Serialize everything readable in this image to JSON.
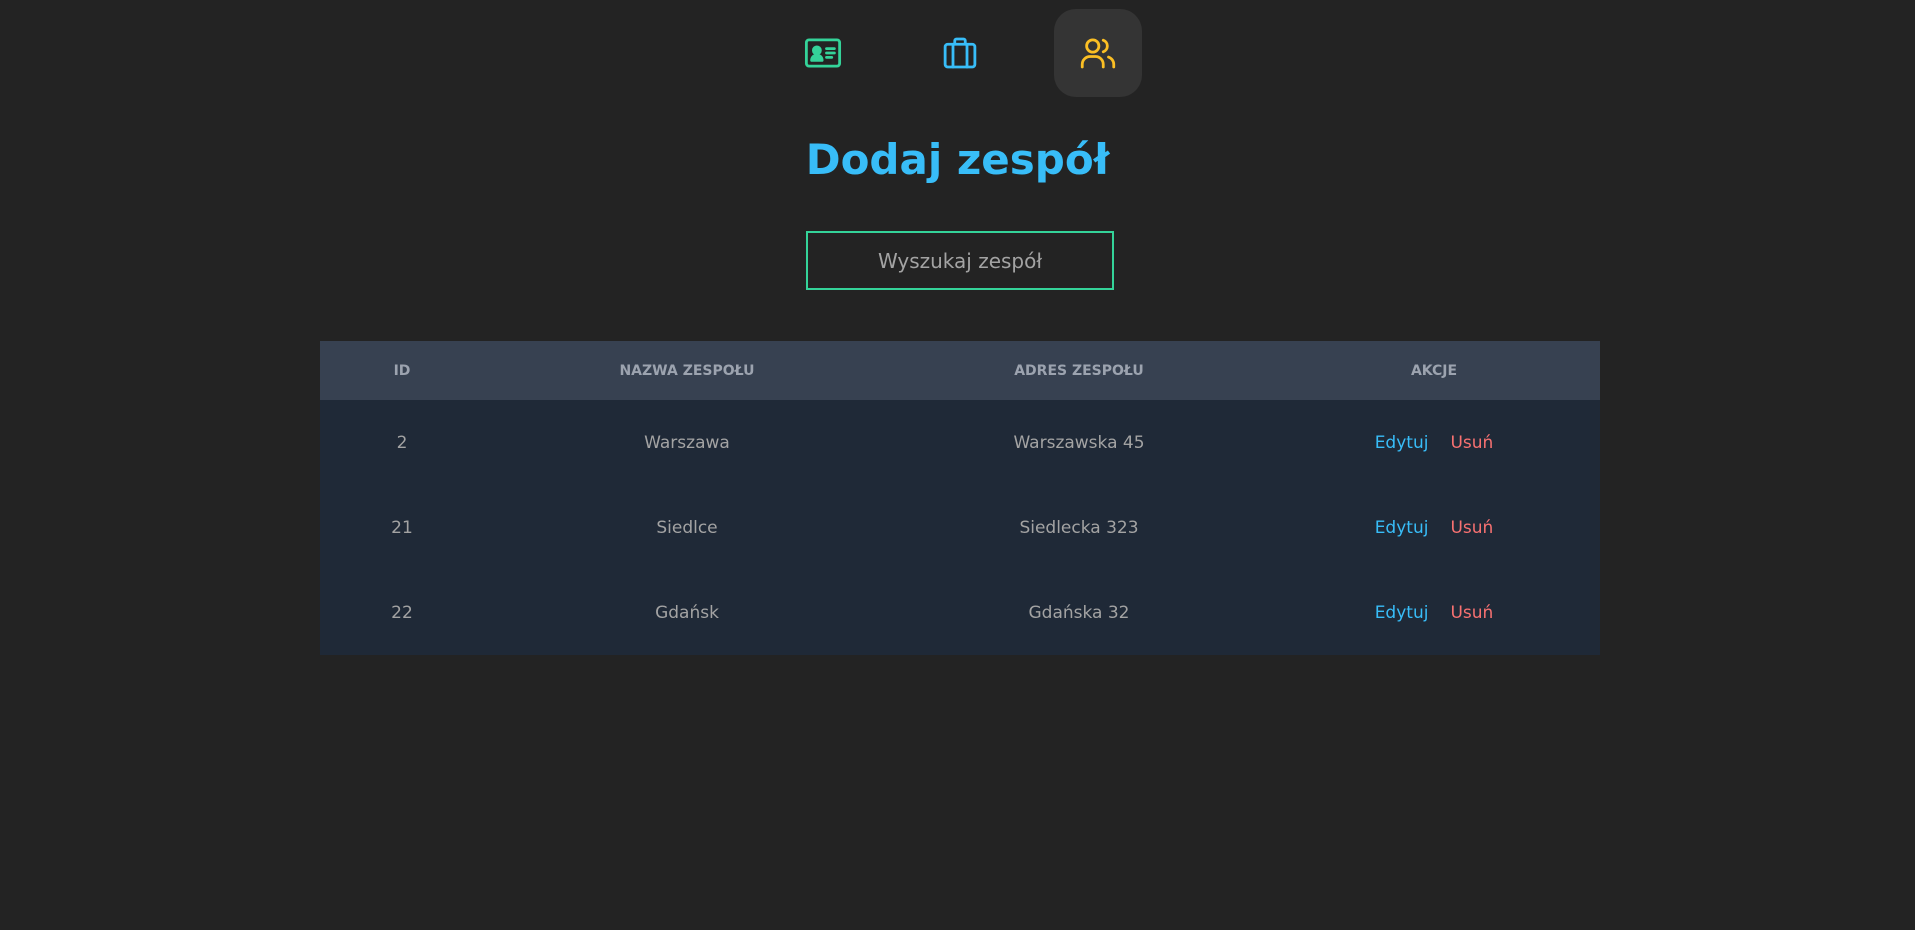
{
  "nav": {
    "items": [
      {
        "icon": "id-card-icon",
        "color": "#34d399",
        "active": false
      },
      {
        "icon": "briefcase-icon",
        "color": "#38bdf8",
        "active": false
      },
      {
        "icon": "users-icon",
        "color": "#fbbf24",
        "active": true
      }
    ]
  },
  "page": {
    "title": "Dodaj zespół"
  },
  "search": {
    "placeholder": "Wyszukaj zespół",
    "value": ""
  },
  "table": {
    "headers": {
      "id": "ID",
      "name": "NAZWA ZESPOŁU",
      "address": "ADRES ZESPOŁU",
      "actions": "AKCJE"
    },
    "rows": [
      {
        "id": "2",
        "name": "Warszawa",
        "address": "Warszawska 45",
        "edit": "Edytuj",
        "delete": "Usuń"
      },
      {
        "id": "21",
        "name": "Siedlce",
        "address": "Siedlecka 323",
        "edit": "Edytuj",
        "delete": "Usuń"
      },
      {
        "id": "22",
        "name": "Gdańsk",
        "address": "Gdańska 32",
        "edit": "Edytuj",
        "delete": "Usuń"
      }
    ]
  },
  "colors": {
    "background": "#232323",
    "accent_blue": "#38bdf8",
    "accent_green": "#34d399",
    "accent_yellow": "#fbbf24",
    "danger": "#f87171",
    "table_header_bg": "#374151",
    "table_row_bg": "#1f2937"
  }
}
